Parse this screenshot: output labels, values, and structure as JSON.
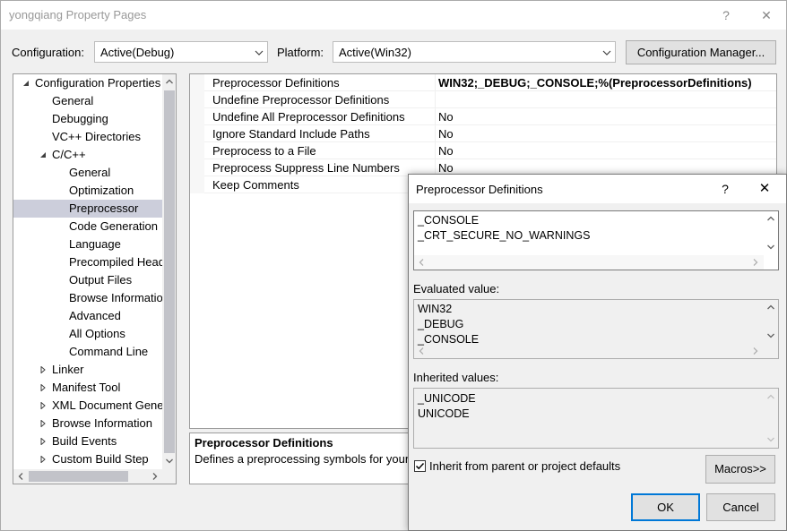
{
  "window": {
    "title": "yongqiang Property Pages",
    "help_glyph": "?",
    "close_glyph": "✕"
  },
  "toolbar": {
    "configuration_label": "Configuration:",
    "configuration_value": "Active(Debug)",
    "platform_label": "Platform:",
    "platform_value": "Active(Win32)",
    "config_manager_label": "Configuration Manager..."
  },
  "tree": {
    "items": [
      {
        "label": "Configuration Properties",
        "level": 0,
        "expander": "expanded"
      },
      {
        "label": "General",
        "level": 1,
        "expander": "none"
      },
      {
        "label": "Debugging",
        "level": 1,
        "expander": "none"
      },
      {
        "label": "VC++ Directories",
        "level": 1,
        "expander": "none"
      },
      {
        "label": "C/C++",
        "level": 1,
        "expander": "expanded"
      },
      {
        "label": "General",
        "level": 2,
        "expander": "none"
      },
      {
        "label": "Optimization",
        "level": 2,
        "expander": "none"
      },
      {
        "label": "Preprocessor",
        "level": 2,
        "expander": "none",
        "selected": true
      },
      {
        "label": "Code Generation",
        "level": 2,
        "expander": "none"
      },
      {
        "label": "Language",
        "level": 2,
        "expander": "none"
      },
      {
        "label": "Precompiled Headers",
        "level": 2,
        "expander": "none"
      },
      {
        "label": "Output Files",
        "level": 2,
        "expander": "none"
      },
      {
        "label": "Browse Information",
        "level": 2,
        "expander": "none"
      },
      {
        "label": "Advanced",
        "level": 2,
        "expander": "none"
      },
      {
        "label": "All Options",
        "level": 2,
        "expander": "none"
      },
      {
        "label": "Command Line",
        "level": 2,
        "expander": "none"
      },
      {
        "label": "Linker",
        "level": 1,
        "expander": "collapsed"
      },
      {
        "label": "Manifest Tool",
        "level": 1,
        "expander": "collapsed"
      },
      {
        "label": "XML Document Generator",
        "level": 1,
        "expander": "collapsed"
      },
      {
        "label": "Browse Information",
        "level": 1,
        "expander": "collapsed"
      },
      {
        "label": "Build Events",
        "level": 1,
        "expander": "collapsed"
      },
      {
        "label": "Custom Build Step",
        "level": 1,
        "expander": "collapsed"
      }
    ]
  },
  "grid": {
    "rows": [
      {
        "name": "Preprocessor Definitions",
        "value": "WIN32;_DEBUG;_CONSOLE;%(PreprocessorDefinitions)",
        "bold": true
      },
      {
        "name": "Undefine Preprocessor Definitions",
        "value": ""
      },
      {
        "name": "Undefine All Preprocessor Definitions",
        "value": "No"
      },
      {
        "name": "Ignore Standard Include Paths",
        "value": "No"
      },
      {
        "name": "Preprocess to a File",
        "value": "No"
      },
      {
        "name": "Preprocess Suppress Line Numbers",
        "value": "No"
      },
      {
        "name": "Keep Comments",
        "value": ""
      }
    ]
  },
  "description": {
    "title": "Preprocessor Definitions",
    "text": "Defines a preprocessing symbols for your source file."
  },
  "dialog": {
    "title": "Preprocessor Definitions",
    "help_glyph": "?",
    "close_glyph": "✕",
    "edit_lines": [
      "_CONSOLE",
      "_CRT_SECURE_NO_WARNINGS"
    ],
    "evaluated_label": "Evaluated value:",
    "evaluated_lines": [
      "WIN32",
      "_DEBUG",
      "_CONSOLE"
    ],
    "inherited_label": "Inherited values:",
    "inherited_lines": [
      "_UNICODE",
      "UNICODE"
    ],
    "inherit_checkbox_label": "Inherit from parent or project defaults",
    "inherit_checked": true,
    "macros_label": "Macros>>",
    "ok_label": "OK",
    "cancel_label": "Cancel"
  },
  "colors": {
    "selection": "#cccedb",
    "default_button_border": "#0078d7"
  }
}
